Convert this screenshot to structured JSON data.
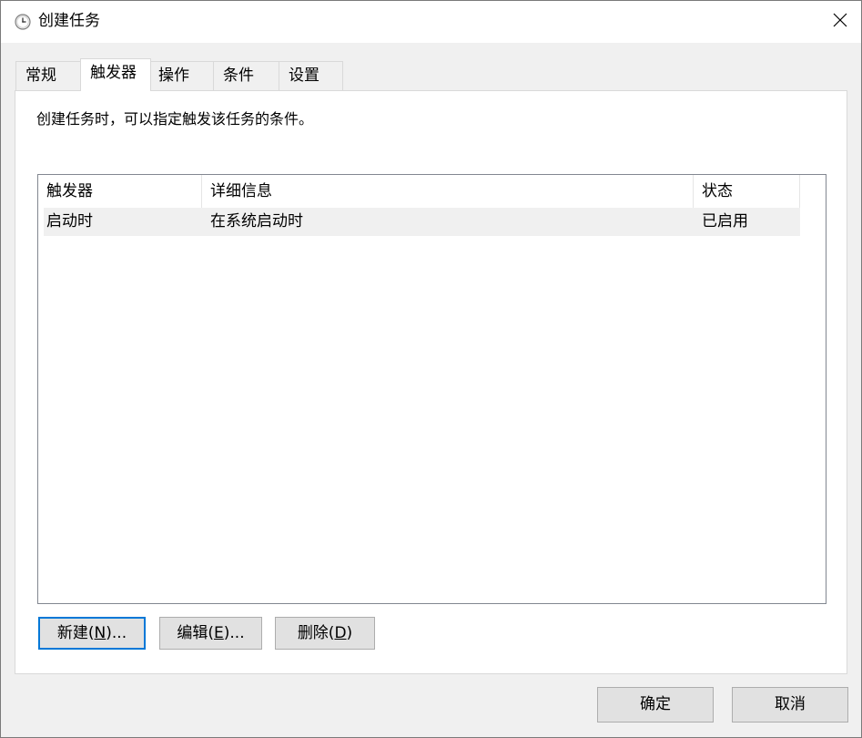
{
  "window": {
    "title": "创建任务",
    "icon": "clock-icon",
    "close_icon": "close-icon"
  },
  "tabs": [
    {
      "label": "常规",
      "active": false
    },
    {
      "label": "触发器",
      "active": true
    },
    {
      "label": "操作",
      "active": false
    },
    {
      "label": "条件",
      "active": false
    },
    {
      "label": "设置",
      "active": false
    }
  ],
  "panel": {
    "description": "创建任务时，可以指定触发该任务的条件。"
  },
  "triggers_list": {
    "columns": [
      "触发器",
      "详细信息",
      "状态"
    ],
    "rows": [
      {
        "trigger": "启动时",
        "details": "在系统启动时",
        "status": "已启用"
      }
    ]
  },
  "buttons": {
    "new_pre": "新建(",
    "new_key": "N",
    "new_post": ")...",
    "edit_pre": "编辑(",
    "edit_key": "E",
    "edit_post": ")...",
    "delete_pre": "删除(",
    "delete_key": "D",
    "delete_post": ")",
    "ok": "确定",
    "cancel": "取消"
  }
}
